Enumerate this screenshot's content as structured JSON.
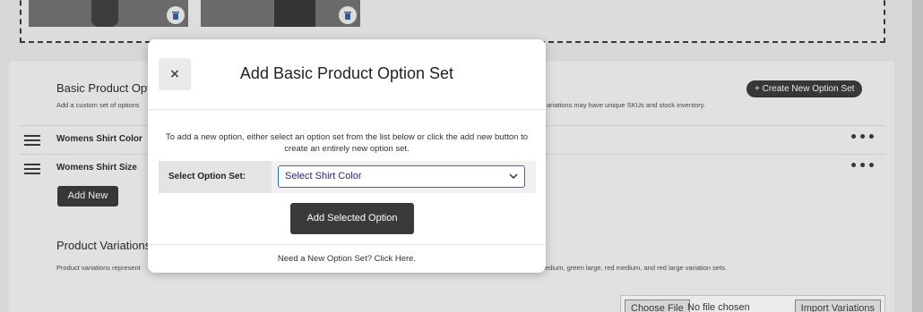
{
  "page": {
    "basic_title": "Basic Product Opt",
    "basic_desc_left": "Add a custom set of options",
    "basic_desc_right": "ariations may have unique SKUs and stock inventory.",
    "create_new_option_set": "+ Create New Option Set",
    "option_rows": [
      {
        "label": "Womens Shirt Color",
        "menu": "•••"
      },
      {
        "label": "Womens Shirt Size",
        "menu": "•••"
      }
    ],
    "add_new_label": "Add New",
    "variations_title": "Product Variations",
    "variations_desc_left": "Product variations represent",
    "variations_desc_right": "edium, green large, red medium, and red large variation sets.",
    "choose_file_label": "Choose File",
    "no_file_text": "No file chosen",
    "import_variations_label": "Import Variations"
  },
  "modal": {
    "close_symbol": "×",
    "title": "Add Basic Product Option Set",
    "instructions_line1": "To add a new option, either select an option set from the list below or click the add new button to",
    "instructions_line2": "create an entirely new option set.",
    "select_label": "Select Option Set:",
    "select_value": "Select Shirt Color",
    "add_selected_label": "Add Selected Option",
    "need_new_text": "Need a New Option Set? Click Here."
  },
  "icons": {
    "trash": "trash-icon",
    "close": "close-icon",
    "chevron": "chevron-down-icon",
    "drag": "drag-handle-icon",
    "more": "more-icon"
  },
  "colors": {
    "select_border": "#2a6ecb",
    "dark_button": "#333333"
  }
}
